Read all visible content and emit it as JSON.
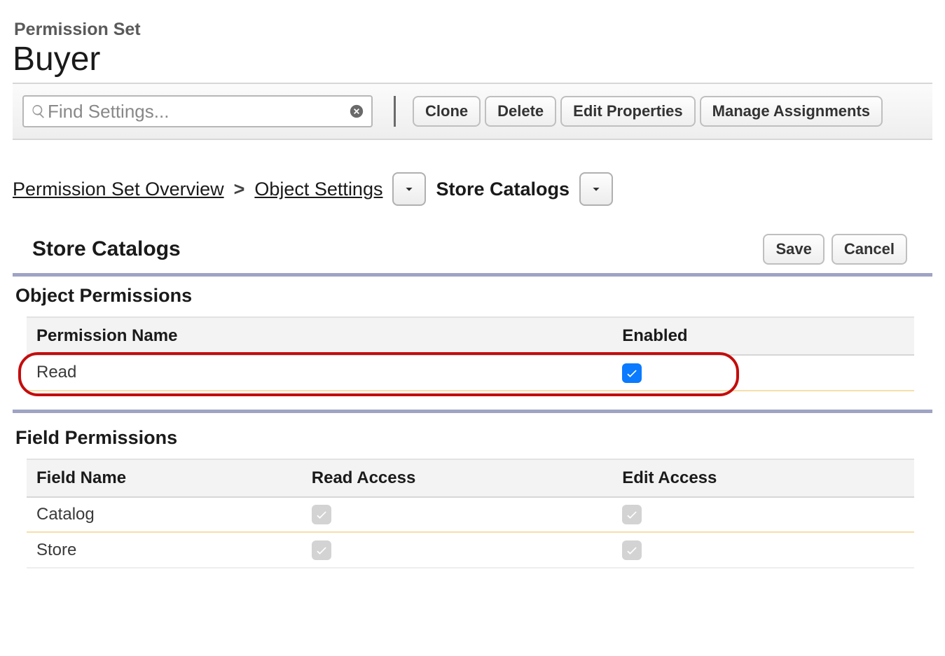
{
  "header": {
    "supertitle": "Permission Set",
    "title": "Buyer"
  },
  "toolbar": {
    "search_placeholder": "Find Settings...",
    "clone": "Clone",
    "delete": "Delete",
    "edit_properties": "Edit Properties",
    "manage_assignments": "Manage Assignments"
  },
  "breadcrumb": {
    "overview": "Permission Set Overview",
    "object_settings": "Object Settings",
    "current": "Store Catalogs"
  },
  "section": {
    "title": "Store Catalogs",
    "save": "Save",
    "cancel": "Cancel"
  },
  "object_permissions": {
    "heading": "Object Permissions",
    "cols": {
      "name": "Permission Name",
      "enabled": "Enabled"
    },
    "rows": [
      {
        "name": "Read",
        "enabled": true,
        "highlighted": true
      }
    ]
  },
  "field_permissions": {
    "heading": "Field Permissions",
    "cols": {
      "name": "Field Name",
      "read": "Read Access",
      "edit": "Edit Access"
    },
    "rows": [
      {
        "name": "Catalog",
        "read_locked": true,
        "edit_locked": true
      },
      {
        "name": "Store",
        "read_locked": true,
        "edit_locked": true
      }
    ]
  }
}
